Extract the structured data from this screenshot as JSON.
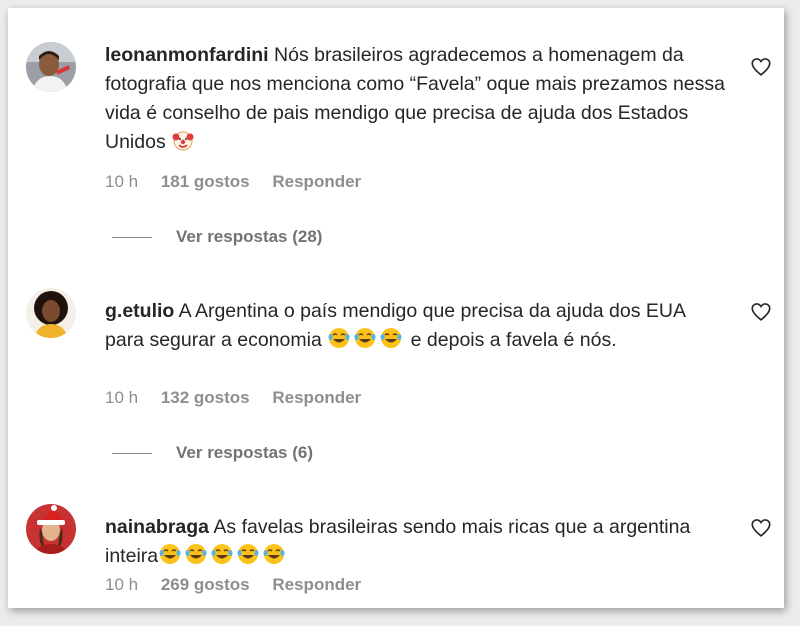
{
  "comments": [
    {
      "username": "leonanmonfardini",
      "text": "Nós brasileiros agradecemos a homenagem da fotografia que nos menciona como “Favela” oque mais prezamos nessa vida é conselho de pais mendigo que precisa de ajuda dos Estados Unidos",
      "trailing_emoji": "clown-emoji",
      "time": "10 h",
      "likes": "181 gostos",
      "reply_label": "Responder",
      "view_replies": "Ver respostas (28)"
    },
    {
      "username": "g.etulio",
      "text_before": "A Argentina o país mendigo que precisa da ajuda dos EUA para segurar a economia",
      "text_after": "e depois a favela é nós.",
      "emoji": "laughing-tears-emoji",
      "time": "10 h",
      "likes": "132 gostos",
      "reply_label": "Responder",
      "view_replies": "Ver respostas (6)"
    },
    {
      "username": "nainabraga",
      "text": "As favelas brasileiras sendo mais ricas que a argentina inteira",
      "emoji": "laughing-tears-emoji",
      "time": "10 h",
      "likes": "269 gostos",
      "reply_label": "Responder"
    }
  ],
  "colors": {
    "text": "#262626",
    "meta": "#8e8e8e",
    "background": "#ffffff"
  }
}
